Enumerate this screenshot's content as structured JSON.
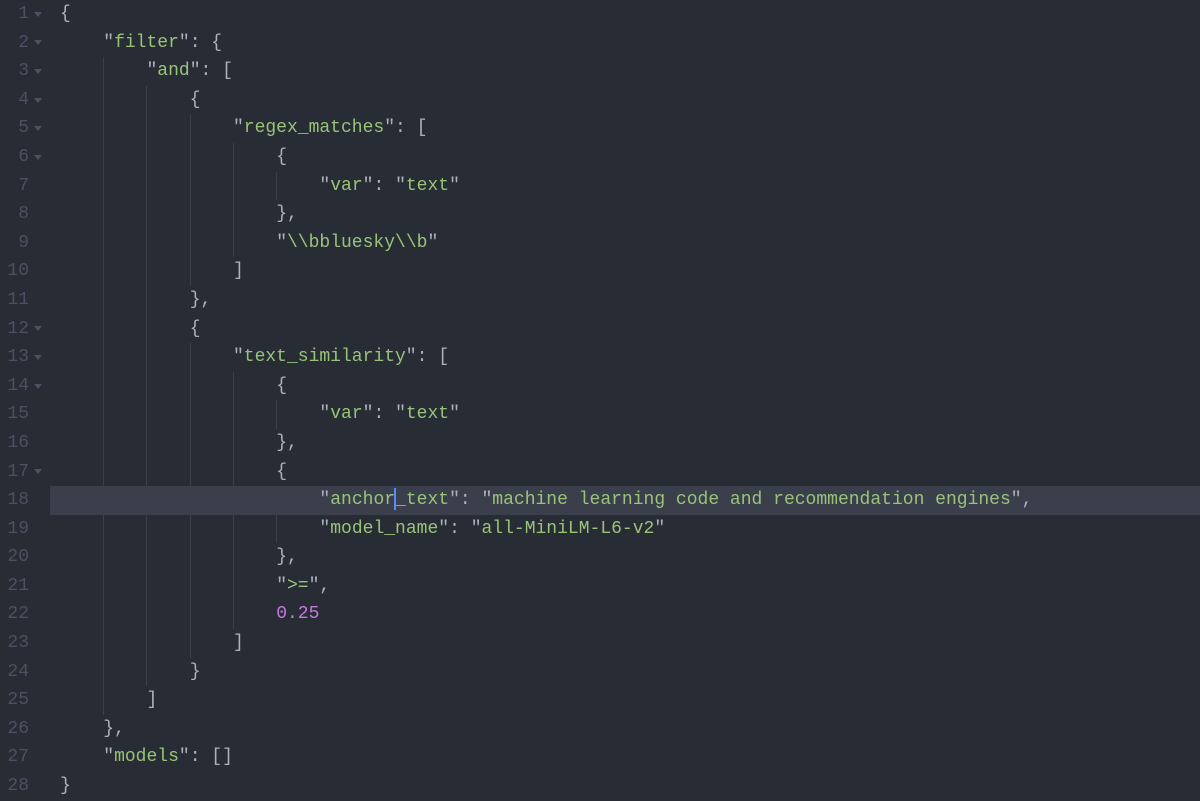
{
  "gutter": {
    "lines": [
      {
        "num": "1",
        "fold": true
      },
      {
        "num": "2",
        "fold": true
      },
      {
        "num": "3",
        "fold": true
      },
      {
        "num": "4",
        "fold": true
      },
      {
        "num": "5",
        "fold": true
      },
      {
        "num": "6",
        "fold": true
      },
      {
        "num": "7",
        "fold": false
      },
      {
        "num": "8",
        "fold": false
      },
      {
        "num": "9",
        "fold": false
      },
      {
        "num": "10",
        "fold": false
      },
      {
        "num": "11",
        "fold": false
      },
      {
        "num": "12",
        "fold": true
      },
      {
        "num": "13",
        "fold": true
      },
      {
        "num": "14",
        "fold": true
      },
      {
        "num": "15",
        "fold": false
      },
      {
        "num": "16",
        "fold": false
      },
      {
        "num": "17",
        "fold": true
      },
      {
        "num": "18",
        "fold": false
      },
      {
        "num": "19",
        "fold": false
      },
      {
        "num": "20",
        "fold": false
      },
      {
        "num": "21",
        "fold": false
      },
      {
        "num": "22",
        "fold": false
      },
      {
        "num": "23",
        "fold": false
      },
      {
        "num": "24",
        "fold": false
      },
      {
        "num": "25",
        "fold": false
      },
      {
        "num": "26",
        "fold": false
      },
      {
        "num": "27",
        "fold": false
      },
      {
        "num": "28",
        "fold": false
      }
    ]
  },
  "code": {
    "cursor_line": 18,
    "indent": "    ",
    "tokens": {
      "open_brace": "{",
      "close_brace": "}",
      "open_bracket": "[",
      "close_bracket": "]",
      "colon": ":",
      "comma": ",",
      "q": "\"",
      "filter": "filter",
      "and": "and",
      "regex_matches": "regex_matches",
      "var": "var",
      "text": "text",
      "bbluesky": "\\\\bbluesky\\\\b",
      "text_similarity": "text_similarity",
      "anchor_pre": "anchor",
      "anchor_post": "_text",
      "anchor_val": "machine learning code and recommendation engines",
      "model_name": "model_name",
      "model_val": "all-MiniLM-L6-v2",
      "gte": ">=",
      "num": "0.25",
      "models": "models"
    }
  }
}
